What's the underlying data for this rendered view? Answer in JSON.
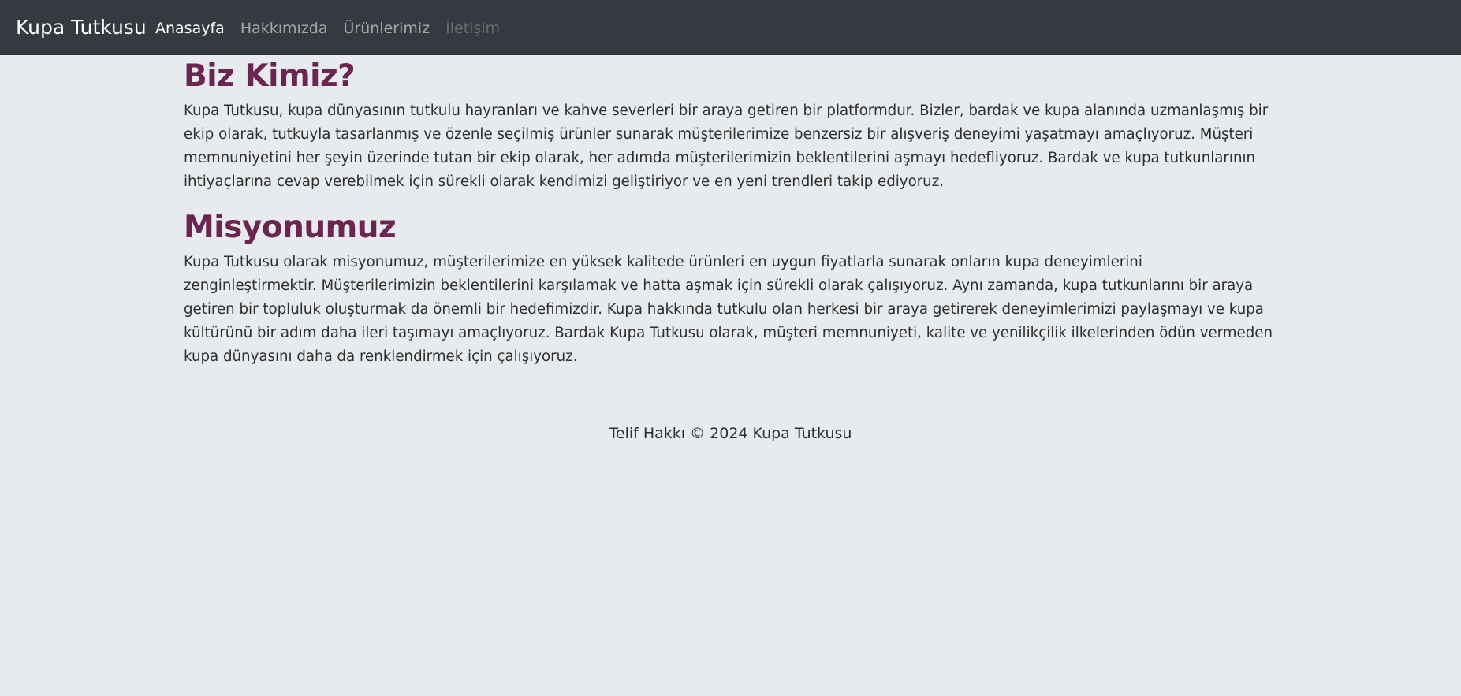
{
  "navbar": {
    "brand": "Kupa Tutkusu",
    "links": [
      {
        "label": "Anasayfa",
        "state": "active"
      },
      {
        "label": "Hakkımızda",
        "state": "normal"
      },
      {
        "label": "Ürünlerimiz",
        "state": "normal"
      },
      {
        "label": "İletişim",
        "state": "disabled"
      }
    ]
  },
  "main": {
    "sections": [
      {
        "title": "Biz Kimiz?",
        "text": "Kupa Tutkusu, kupa dünyasının tutkulu hayranları ve kahve severleri bir araya getiren bir platformdur. Bizler, bardak ve kupa alanında uzmanlaşmış bir ekip olarak, tutkuyla tasarlanmış ve özenle seçilmiş ürünler sunarak müşterilerimize benzersiz bir alışveriş deneyimi yaşatmayı amaçlıyoruz. Müşteri memnuniyetini her şeyin üzerinde tutan bir ekip olarak, her adımda müşterilerimizin beklentilerini aşmayı hedefliyoruz. Bardak ve kupa tutkunlarının ihtiyaçlarına cevap verebilmek için sürekli olarak kendimizi geliştiriyor ve en yeni trendleri takip ediyoruz."
      },
      {
        "title": "Misyonumuz",
        "text": "Kupa Tutkusu olarak misyonumuz, müşterilerimize en yüksek kalitede ürünleri en uygun fiyatlarla sunarak onların kupa deneyimlerini zenginleştirmektir. Müşterilerimizin beklentilerini karşılamak ve hatta aşmak için sürekli olarak çalışıyoruz. Aynı zamanda, kupa tutkunlarını bir araya getiren bir topluluk oluşturmak da önemli bir hedefimizdir. Kupa hakkında tutkulu olan herkesi bir araya getirerek deneyimlerimizi paylaşmayı ve kupa kültürünü bir adım daha ileri taşımayı amaçlıyoruz. Bardak Kupa Tutkusu olarak, müşteri memnuniyeti, kalite ve yenilikçilik ilkelerinden ödün vermeden kupa dünyasını daha da renklendirmek için çalışıyoruz."
      }
    ]
  },
  "footer": {
    "text": "Telif Hakkı © 2024 Kupa Tutkusu"
  },
  "colors": {
    "navbar_bg": "#343a40",
    "page_bg": "#e8ebee",
    "heading": "#6b2551"
  }
}
